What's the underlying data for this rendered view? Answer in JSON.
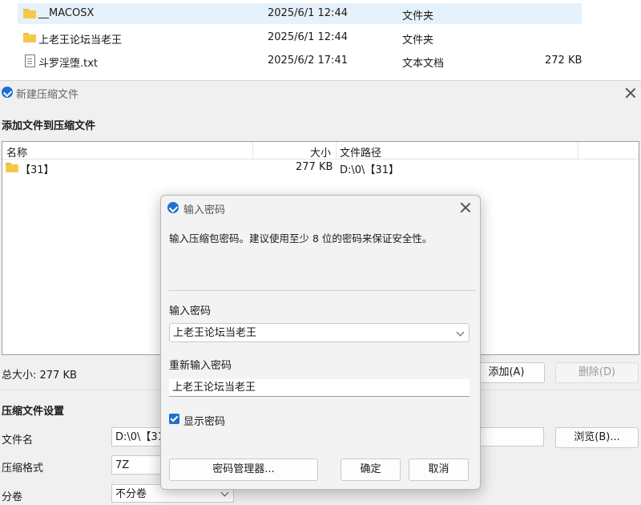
{
  "explorer": {
    "rows": [
      {
        "name": "__MACOSX",
        "date": "2025/6/1 12:44",
        "type": "文件夹",
        "size": ""
      },
      {
        "name": "上老王论坛当老王",
        "date": "2025/6/1 12:44",
        "type": "文件夹",
        "size": ""
      },
      {
        "name": "斗罗淫堕.txt",
        "date": "2025/6/2 17:41",
        "type": "文本文档",
        "size": "272 KB"
      }
    ]
  },
  "main_dialog": {
    "title": "新建压缩文件",
    "section_add": "添加文件到压缩文件",
    "columns": {
      "name": "名称",
      "size": "大小",
      "path": "文件路径"
    },
    "files": [
      {
        "name": "【31】",
        "size": "277 KB",
        "path": "D:\\0\\【31】"
      }
    ],
    "total_size": "总大小: 277 KB",
    "add_button": "添加(A)",
    "delete_button": "删除(D)",
    "section_settings": "压缩文件设置",
    "filename_label": "文件名",
    "filename_value": "D:\\0\\【31",
    "browse_button": "浏览(B)...",
    "format_label": "压缩格式",
    "format_value": "7Z",
    "split_label": "分卷",
    "split_value": "不分卷"
  },
  "password_dialog": {
    "title": "输入密码",
    "description": "输入压缩包密码。建议使用至少 8 位的密码来保证安全性。",
    "password_label": "输入密码",
    "password_value": "上老王论坛当老王",
    "reenter_label": "重新输入密码",
    "reenter_value": "上老王论坛当老王",
    "show_password_label": "显示密码",
    "show_password_checked": true,
    "manager_button": "密码管理器...",
    "ok_button": "确定",
    "cancel_button": "取消"
  },
  "colors": {
    "accent": "#1f6fd1",
    "selection": "#e5f1fb",
    "folder": "#f5c84c"
  }
}
